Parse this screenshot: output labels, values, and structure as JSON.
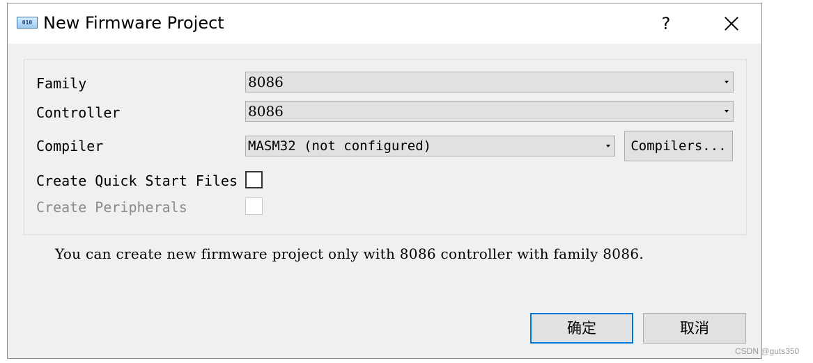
{
  "window": {
    "title": "New Firmware Project",
    "app_icon_text": "010",
    "help_label": "?",
    "close_icon": "close-icon"
  },
  "form": {
    "family": {
      "label": "Family",
      "value": "8086"
    },
    "controller": {
      "label": "Controller",
      "value": "8086"
    },
    "compiler": {
      "label": "Compiler",
      "value": "MASM32 (not configured)",
      "button_label": "Compilers..."
    },
    "quick_start": {
      "label": "Create Quick Start Files",
      "checked": false,
      "enabled": true
    },
    "peripherals": {
      "label": "Create Peripherals",
      "checked": false,
      "enabled": false
    }
  },
  "info_message": "You can create new firmware project only with 8086 controller with family 8086.",
  "buttons": {
    "ok_label": "确定",
    "cancel_label": "取消"
  },
  "watermark": "CSDN @guts350",
  "colors": {
    "focus_border": "#0078d7",
    "dialog_bg": "#f0f0f0",
    "control_bg": "#e1e1e1"
  }
}
